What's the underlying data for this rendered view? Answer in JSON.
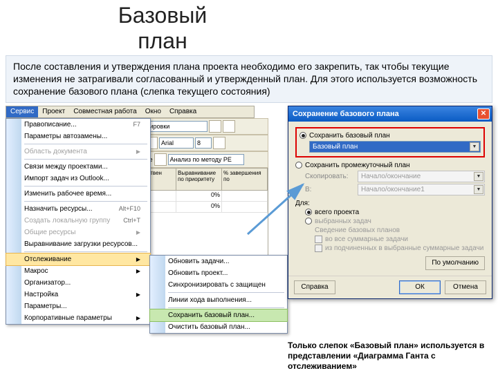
{
  "title": "Базовый план",
  "description": "После составления и утверждения плана проекта необходимо его закрепить, так чтобы текущие изменения не затрагивали согласованный и утвержденный план. Для этого используется возможность сохранение базового плана (слепка текущего состояния)",
  "menubar": {
    "items": [
      "Сервис",
      "Проект",
      "Совместная работа",
      "Окно",
      "Справка"
    ]
  },
  "toolbar": {
    "font": "Arial",
    "size": "8",
    "group_label": "Группировки",
    "office_label": "в Office",
    "attach": "Анализ по методу PE"
  },
  "menu": {
    "items": [
      {
        "label": "Правописание...",
        "shortcut": "F7"
      },
      {
        "label": "Параметры автозамены..."
      },
      {
        "label": "Область документа",
        "sub": true,
        "disabled": true
      },
      {
        "label": "Связи между проектами..."
      },
      {
        "label": "Импорт задач из Outlook..."
      },
      {
        "label": "Изменить рабочее время..."
      },
      {
        "label": "Назначить ресурсы...",
        "shortcut": "Alt+F10"
      },
      {
        "label": "Создать локальную группу",
        "shortcut": "Ctrl+T",
        "disabled": true
      },
      {
        "label": "Общие ресурсы",
        "sub": true
      },
      {
        "label": "Выравнивание загрузки ресурсов..."
      },
      {
        "label": "Отслеживание",
        "sub": true,
        "hl": true
      },
      {
        "label": "Макрос",
        "sub": true
      },
      {
        "label": "Организатор..."
      },
      {
        "label": "Настройка",
        "sub": true
      },
      {
        "label": "Параметры..."
      },
      {
        "label": "Корпоративные параметры",
        "sub": true
      }
    ]
  },
  "submenu": {
    "items": [
      {
        "label": "Обновить задачи..."
      },
      {
        "label": "Обновить проект..."
      },
      {
        "label": "Синхронизировать с защищен"
      },
      {
        "label": "Линии хода выполнения..."
      },
      {
        "label": "Сохранить базовый план...",
        "green": true
      },
      {
        "label": "Очистить базовый план..."
      }
    ]
  },
  "columns": {
    "hdrs": [
      "единнствен",
      "Выравнивание по приоритету",
      "% завершения по"
    ],
    "rows": [
      [
        "",
        "0%",
        ""
      ],
      [
        "",
        "0%",
        ""
      ]
    ]
  },
  "dialog": {
    "title": "Сохранение базового плана",
    "opt_save_base": "Сохранить базовый план",
    "base_dd": "Базовый план",
    "opt_save_interim": "Сохранить промежуточный план",
    "copy_lbl": "Скопировать:",
    "copy_val": "Начало/окончание",
    "into_lbl": "В:",
    "into_val": "Начало/окончание1",
    "for_lbl": "Для:",
    "for_all": "всего проекта",
    "for_sel": "выбранных задач",
    "sum_lbl": "Сведение базовых планов",
    "chk1": "во все суммарные задачи",
    "chk2": "из подчиненных в выбранные суммарные задачи",
    "btn_default": "По умолчанию",
    "btn_help": "Справка",
    "btn_ok": "ОК",
    "btn_cancel": "Отмена"
  },
  "note": "Только слепок «Базовый план» используется в представлении «Диаграмма Ганта с отслеживанием»"
}
